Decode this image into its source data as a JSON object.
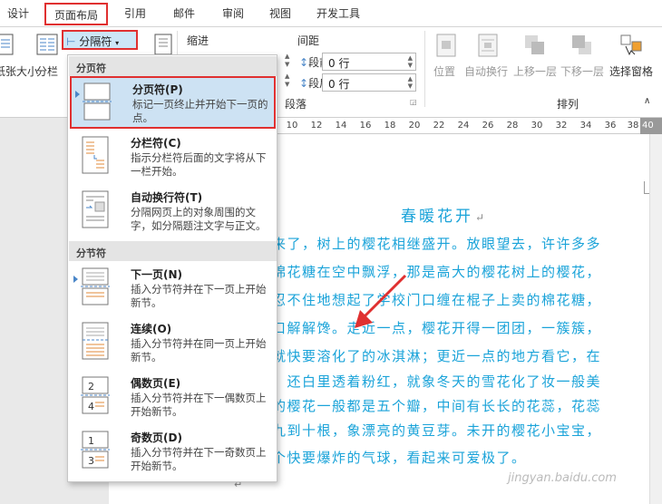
{
  "tabs": [
    {
      "label": "设计",
      "active": false
    },
    {
      "label": "页面布局",
      "active": true
    },
    {
      "label": "引用",
      "active": false
    },
    {
      "label": "邮件",
      "active": false
    },
    {
      "label": "审阅",
      "active": false
    },
    {
      "label": "视图",
      "active": false
    },
    {
      "label": "开发工具",
      "active": false
    }
  ],
  "ribbon": {
    "size_label": "纸张大小",
    "columns_label": "分栏",
    "breaks_button_label": "分隔符",
    "indent_label": "缩进",
    "spacing_label": "间距",
    "spacing_before_label": "段前:",
    "spacing_before_value": "0 行",
    "spacing_after_label": "段后:",
    "spacing_after_value": "0 行",
    "paragraph_group_label": "段落",
    "position_label": "位置",
    "wrap_label": "自动换行",
    "bring_forward_label": "上移一层",
    "send_backward_label": "下移一层",
    "selection_pane_label": "选择窗格",
    "arrange_group_label": "排列"
  },
  "ruler": {
    "ticks": [
      "10",
      "12",
      "14",
      "16",
      "18",
      "20",
      "22",
      "24",
      "26",
      "28",
      "30",
      "32",
      "34",
      "36",
      "38",
      "40"
    ]
  },
  "dropdown": {
    "page_breaks_header": "分页符",
    "section_breaks_header": "分节符",
    "items": [
      {
        "title": "分页符(P)",
        "desc": "标记一页终止并开始下一页的点。"
      },
      {
        "title": "分栏符(C)",
        "desc": "指示分栏符后面的文字将从下一栏开始。"
      },
      {
        "title": "自动换行符(T)",
        "desc": "分隔网页上的对象周围的文字，如分隔题注文字与正文。"
      },
      {
        "title": "下一页(N)",
        "desc": "插入分节符并在下一页上开始新节。"
      },
      {
        "title": "连续(O)",
        "desc": "插入分节符并在同一页上开始新节。"
      },
      {
        "title": "偶数页(E)",
        "desc": "插入分节符并在下一偶数页上开始新节。"
      },
      {
        "title": "奇数页(D)",
        "desc": "插入分节符并在下一奇数页上开始新节。"
      }
    ]
  },
  "document": {
    "title": "春暖花开",
    "lines": [
      "来了，树上的樱花相继盛开。放眼望去，许许多多",
      "棉花糖在空中飘浮，那是高大的樱花树上的樱花，",
      "忍不住地想起了学校门口缠在棍子上卖的棉花糖，",
      "口解解馋。走近一点，樱花开得一团团，一簇簇，",
      "就快要溶化了的冰淇淋；更近一点的地方看它，在",
      "，还白里透着粉红，就象冬天的雪花化了妆一般美",
      "的樱花一般都是五个瓣，中间有长长的花蕊，花蕊",
      "九到十根，象漂亮的黄豆芽。未开的樱花小宝宝，",
      "个快要爆炸的气球，看起来可爱极了。"
    ]
  },
  "watermark": "jingyan.baidu.com",
  "colors": {
    "accent_red": "#e03030",
    "doc_text": "#1aa3d9",
    "hover_blue": "#cde2f3"
  }
}
